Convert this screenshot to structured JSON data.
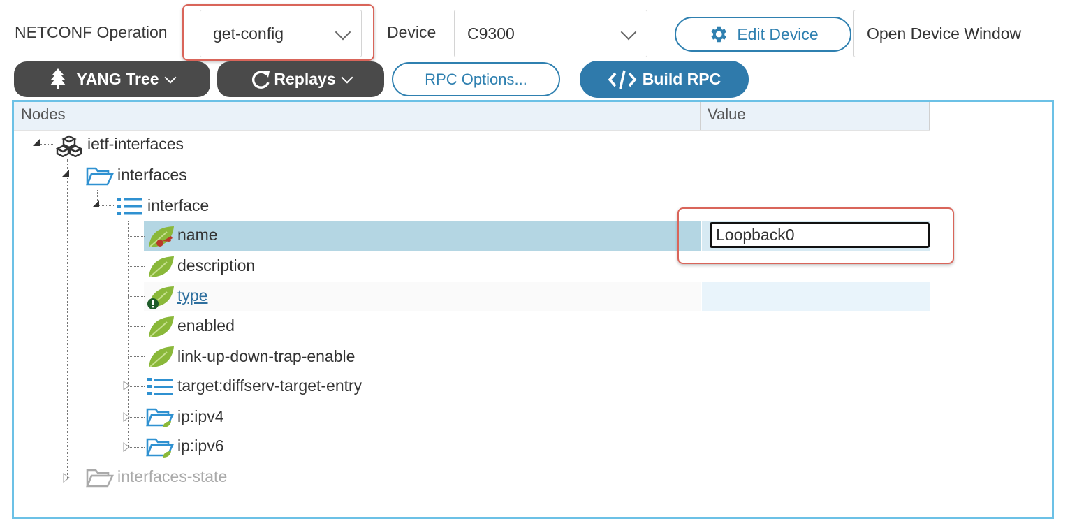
{
  "toolbar": {
    "operation_label": "NETCONF Operation",
    "operation_value": "get-config",
    "device_label": "Device",
    "device_value": "C9300",
    "edit_device": "Edit Device",
    "open_window": "Open Device Window",
    "yang_tree": "YANG Tree",
    "replays": "Replays",
    "rpc_options": "RPC Options...",
    "build_rpc": "Build RPC"
  },
  "tree": {
    "col_nodes": "Nodes",
    "col_value": "Value",
    "nodes": {
      "ietf_interfaces": "ietf-interfaces",
      "interfaces": "interfaces",
      "interface": "interface",
      "name": "name",
      "description": "description",
      "type": "type",
      "enabled": "enabled",
      "link_up_down": "link-up-down-trap-enable",
      "diffserv": "target:diffserv-target-entry",
      "ipv4": "ip:ipv4",
      "ipv6": "ip:ipv6",
      "interfaces_state": "interfaces-state"
    },
    "name_value": "Loopback0"
  },
  "colors": {
    "accent": "#2f7aab",
    "highlight": "#d9655a",
    "selected_row": "#b4d6e3",
    "leaf_green": "#8ab83a"
  },
  "icons": {
    "yang_tree": "tree-icon",
    "replays": "refresh-icon",
    "edit_device": "gear-icon",
    "build_rpc": "code-icon",
    "module": "module-icon",
    "container": "folder-icon",
    "list": "list-icon",
    "leaf": "leaf-icon",
    "key_leaf": "key-icon",
    "mandatory": "exclamation-icon"
  }
}
